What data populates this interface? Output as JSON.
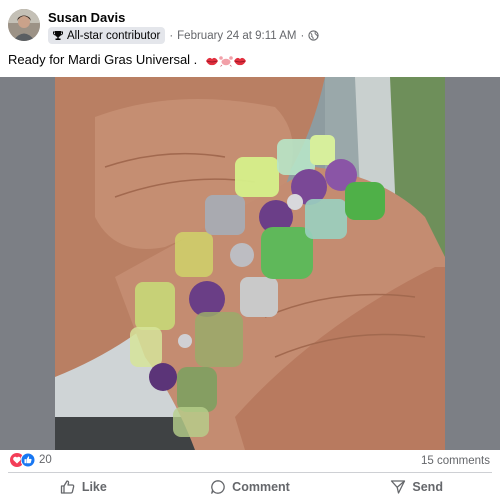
{
  "post": {
    "author": "Susan Davis",
    "badge": "All-star contributor",
    "timestamp": "February 24 at 9:11 AM",
    "audience_icon": "globe-icon",
    "caption": "Ready for Mardi Gras Universal .",
    "caption_emojis": [
      "lips-emoji",
      "crab-emoji",
      "lips-emoji"
    ]
  },
  "photo": {
    "subject": "wrist-with-beaded-bracelets",
    "bead_colors": [
      "#c8d878",
      "#d6f08a",
      "#6a3e86",
      "#5fb85a",
      "#9ad0c0",
      "#c9c9c9"
    ]
  },
  "engagement": {
    "reaction_icons": [
      "love-icon",
      "like-icon"
    ],
    "reaction_count": "20",
    "comment_count": "15 comments"
  },
  "actions": {
    "like_label": "Like",
    "comment_label": "Comment",
    "send_label": "Send"
  },
  "colors": {
    "facebook_blue": "#1877f2",
    "love_red": "#f33e58",
    "secondary_text": "#65676b"
  }
}
